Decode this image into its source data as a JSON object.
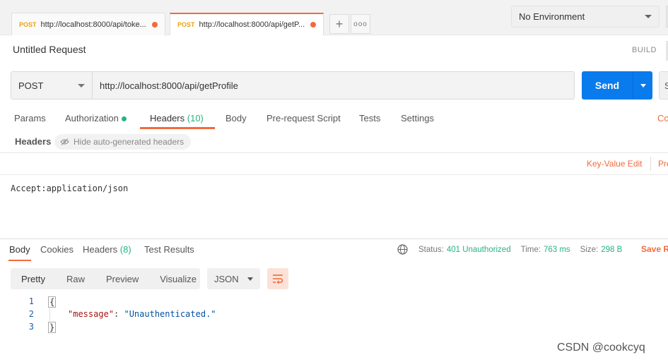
{
  "tabs": [
    {
      "method": "POST",
      "url": "http://localhost:8000/api/toke..."
    },
    {
      "method": "POST",
      "url": "http://localhost:8000/api/getP..."
    }
  ],
  "tab_actions": {
    "add": "+",
    "more": "ooo"
  },
  "environment": {
    "selected": "No Environment"
  },
  "request": {
    "title": "Untitled Request",
    "build_label": "BUILD",
    "method": "POST",
    "url": "http://localhost:8000/api/getProfile",
    "send_label": "Send",
    "save_edge": "S"
  },
  "request_tabs": {
    "params": "Params",
    "authorization": "Authorization",
    "headers": "Headers",
    "headers_count": "(10)",
    "body": "Body",
    "prerequest": "Pre-request Script",
    "tests": "Tests",
    "settings": "Settings",
    "cookies_edge": "Co"
  },
  "headers_panel": {
    "label": "Headers",
    "hide_auto": "Hide auto-generated headers",
    "key_value_edit": "Key-Value Edit",
    "presets_edge": "Pre",
    "bulk_text": "Accept:application/json"
  },
  "response": {
    "tabs": {
      "body": "Body",
      "cookies": "Cookies",
      "headers": "Headers",
      "headers_count": "(8)",
      "test_results": "Test Results"
    },
    "status_label": "Status:",
    "status_value": "401 Unauthorized",
    "time_label": "Time:",
    "time_value": "763 ms",
    "size_label": "Size:",
    "size_value": "298 B",
    "save_label": "Save R",
    "views": [
      "Pretty",
      "Raw",
      "Preview",
      "Visualize"
    ],
    "format": "JSON",
    "code_lines": [
      {
        "num": "1",
        "open": "{"
      },
      {
        "num": "2",
        "key": "\"message\"",
        "sep": ": ",
        "value": "\"Unauthenticated.\""
      },
      {
        "num": "3",
        "close": "}"
      }
    ]
  },
  "watermark": "CSDN @cookcyq",
  "colors": {
    "accent": "#f26b3a",
    "send": "#097bed",
    "success": "#26b47f",
    "method": "#e8a317"
  }
}
